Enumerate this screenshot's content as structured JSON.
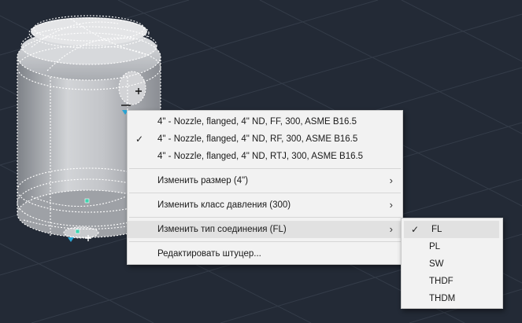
{
  "context_menu": {
    "items": [
      {
        "label": "4\" - Nozzle, flanged, 4\" ND, FF, 300, ASME B16.5",
        "checked": false
      },
      {
        "label": "4\" - Nozzle, flanged, 4\" ND, RF, 300, ASME B16.5",
        "checked": true
      },
      {
        "label": "4\" - Nozzle, flanged, 4\" ND, RTJ, 300, ASME B16.5",
        "checked": false
      },
      {
        "label": "Изменить размер (4\")",
        "submenu": true
      },
      {
        "label": "Изменить класс давления (300)",
        "submenu": true
      },
      {
        "label": "Изменить тип соединения (FL)",
        "submenu": true,
        "highlighted": true
      },
      {
        "label": "Редактировать штуцер..."
      }
    ],
    "check_glyph": "✓",
    "arrow_glyph": "›"
  },
  "submenu": {
    "items": [
      {
        "label": "FL",
        "checked": true
      },
      {
        "label": "PL"
      },
      {
        "label": "SW"
      },
      {
        "label": "THDF"
      },
      {
        "label": "THDM"
      }
    ]
  },
  "colors": {
    "background": "#232a36",
    "grid": "#3a4250",
    "vessel": "#b9bcc1",
    "selection_grip": "#2aa6d6",
    "menu_bg": "#f2f2f2",
    "menu_highlight": "#e1e1e1"
  },
  "icons": [
    "cursor-crosshair-icon",
    "grip-arrow-icon",
    "check-icon",
    "chevron-right-icon"
  ]
}
